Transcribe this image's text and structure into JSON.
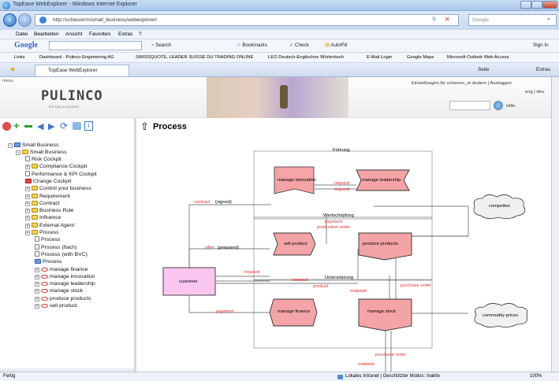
{
  "window": {
    "title": "TopEase WebExplorer - Windows Internet Explorer"
  },
  "address": {
    "url": "http://scheurerm/small_business/webexplorer/",
    "search_placeholder": "Google"
  },
  "menu": {
    "items": [
      "Datei",
      "Bearbeiten",
      "Ansicht",
      "Favoriten",
      "Extras",
      "?"
    ]
  },
  "google_toolbar": {
    "logo": "Google",
    "search_label": "Search",
    "bookmarks_label": "Bookmarks",
    "check_label": "Check",
    "autofill_label": "AutoFill",
    "signin_label": "Sign In"
  },
  "links": {
    "label": "Links",
    "items": [
      "Dashboard - Pulinco Engineering AG",
      "SWISSQUOTE, LEADER SUISSE DU TRADING ONLINE",
      "LEO Deutsch-Englisches Wörterbuch",
      "E-Mail Login",
      "Google Maps",
      "Microsoft Outlook Web Access"
    ]
  },
  "tab": {
    "title": "TopEase WebExplorer",
    "page_label": "Seite",
    "extras_label": "Extras"
  },
  "app": {
    "menu_label": "menu",
    "logo_text": "PULINCO",
    "logo_tagline": "the way to success",
    "user_text": "Einstellungen für scheurer_m ändern | Ausloggen",
    "lang_text": "eng | deu",
    "help_label": "Hilfe"
  },
  "tree": {
    "root": "Small Business",
    "child": "Small Business",
    "items": [
      {
        "label": "Risk Cockpit",
        "icon": "doc",
        "level": 2
      },
      {
        "label": "Compliance Cockpit",
        "icon": "folder",
        "level": 2
      },
      {
        "label": "Performance & KPI Cockpit",
        "icon": "doc",
        "level": 2
      },
      {
        "label": "Change Cockpit",
        "icon": "red",
        "level": 2
      },
      {
        "label": "Control your business",
        "icon": "folder",
        "level": 2
      },
      {
        "label": "Requirement",
        "icon": "folder",
        "level": 2
      },
      {
        "label": "Contract",
        "icon": "folder",
        "level": 2
      },
      {
        "label": "Business Rule",
        "icon": "folder",
        "level": 2
      },
      {
        "label": "Influence",
        "icon": "folder",
        "level": 2
      },
      {
        "label": "External Agent",
        "icon": "folder",
        "level": 2
      },
      {
        "label": "Process",
        "icon": "folder",
        "level": 2
      },
      {
        "label": "Process",
        "icon": "doc",
        "level": 3
      },
      {
        "label": "Process (flach)",
        "icon": "doc",
        "level": 3
      },
      {
        "label": "Process (with BVC)",
        "icon": "doc",
        "level": 3
      },
      {
        "label": "Process",
        "icon": "blue",
        "level": 3
      },
      {
        "label": "manage finance",
        "icon": "oval",
        "level": 3
      },
      {
        "label": "manage innovation",
        "icon": "oval",
        "level": 3
      },
      {
        "label": "manage leadership",
        "icon": "oval",
        "level": 3
      },
      {
        "label": "manage stock",
        "icon": "oval",
        "level": 3
      },
      {
        "label": "produce products",
        "icon": "oval",
        "level": 3
      },
      {
        "label": "sell product",
        "icon": "oval",
        "level": 3
      }
    ]
  },
  "diagram": {
    "title": "Process",
    "zones": {
      "top": "Führung",
      "middle": "Wertschöpfung",
      "bottom": "Unterstützung"
    },
    "nodes": {
      "manage_innovation": "manage innovation",
      "manage_leadership": "manage leadership",
      "sell_product": "sell product",
      "produce_products": "produce products",
      "manage_finance": "manage finance",
      "manage_stock": "manage stock",
      "customer": "customer",
      "competitor": "competitor",
      "commodity_prices": "commodity prices"
    },
    "edges": {
      "request1": "request",
      "request2": "request",
      "contract_signed_a": "contract",
      "contract_signed_b": "(signed)",
      "offer_a": "offer",
      "offer_b": "(prepared)",
      "request3": "request",
      "contract": "contract",
      "product": "product",
      "payment_top": "payment",
      "production_order": "production order",
      "material1": "material",
      "purchase_order1": "purchase order",
      "payment_bottom": "payment",
      "purchase_order2": "purchase order",
      "material2": "material"
    }
  },
  "status": {
    "left": "Fertig",
    "zone": "Lokales Intranet | Geschützter Modus: Inaktiv",
    "zoom": "100%"
  }
}
